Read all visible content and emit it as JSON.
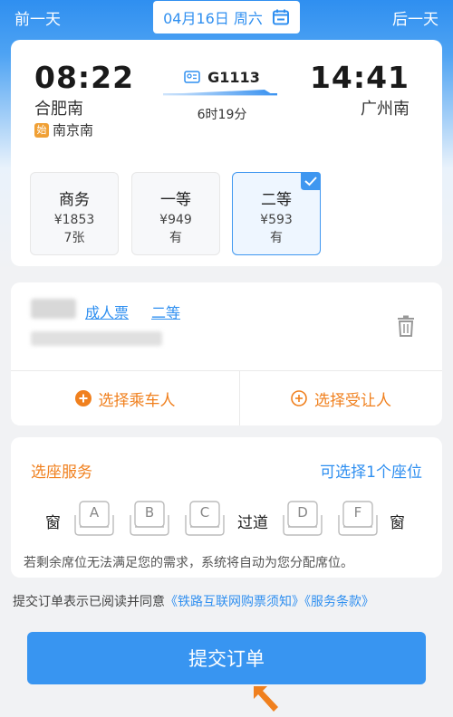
{
  "topbar": {
    "prev_day": "前一天",
    "next_day": "后一天",
    "date": "04月16日 周六"
  },
  "train": {
    "departure_time": "08:22",
    "departure_station": "合肥南",
    "origin_badge": "始",
    "origin_station": "南京南",
    "train_number": "G1113",
    "duration": "6时19分",
    "arrival_time": "14:41",
    "arrival_station": "广州南"
  },
  "seat_classes": [
    {
      "name": "商务",
      "price": "¥1853",
      "availability": "7张",
      "selected": false
    },
    {
      "name": "一等",
      "price": "¥949",
      "availability": "有",
      "selected": false
    },
    {
      "name": "二等",
      "price": "¥593",
      "availability": "有",
      "selected": true
    }
  ],
  "passenger": {
    "ticket_type": "成人票",
    "seat_class": "二等",
    "select_passenger": "选择乘车人",
    "select_beneficiary": "选择受让人"
  },
  "seat_service": {
    "title": "选座服务",
    "quota": "可选择1个座位",
    "window_left": "窗",
    "aisle": "过道",
    "window_right": "窗",
    "seats": [
      "A",
      "B",
      "C",
      "D",
      "F"
    ],
    "note": "若剩余席位无法满足您的需求，系统将自动为您分配席位。"
  },
  "agreement": {
    "prefix": "提交订单表示已阅读并同意",
    "link1": "《铁路互联网购票须知》",
    "link2": "《服务条款》"
  },
  "submit_label": "提交订单",
  "colors": {
    "accent": "#2f8ff0",
    "orange": "#f0801e",
    "submit": "#3895f1"
  }
}
